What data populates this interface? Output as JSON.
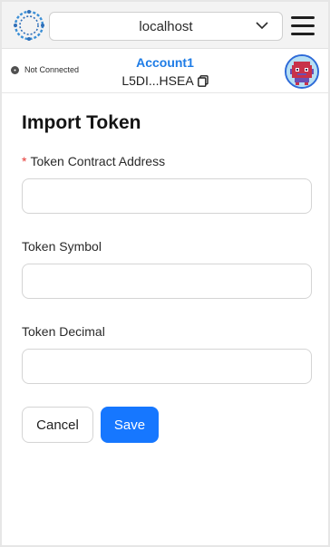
{
  "header": {
    "network": "localhost",
    "logo_icon": "network-logo-icon",
    "menu_icon": "hamburger-menu-icon"
  },
  "account": {
    "status": "Not Connected",
    "name": "Account1",
    "address": "L5DI...HSEA",
    "name_color": "#1e7ce6"
  },
  "form": {
    "title": "Import Token",
    "required_mark": "*",
    "address_label": "Token Contract Address",
    "address_value": "",
    "symbol_label": "Token Symbol",
    "symbol_value": "",
    "decimal_label": "Token Decimal",
    "decimal_value": "",
    "cancel_label": "Cancel",
    "save_label": "Save",
    "accent": "#1677ff"
  }
}
